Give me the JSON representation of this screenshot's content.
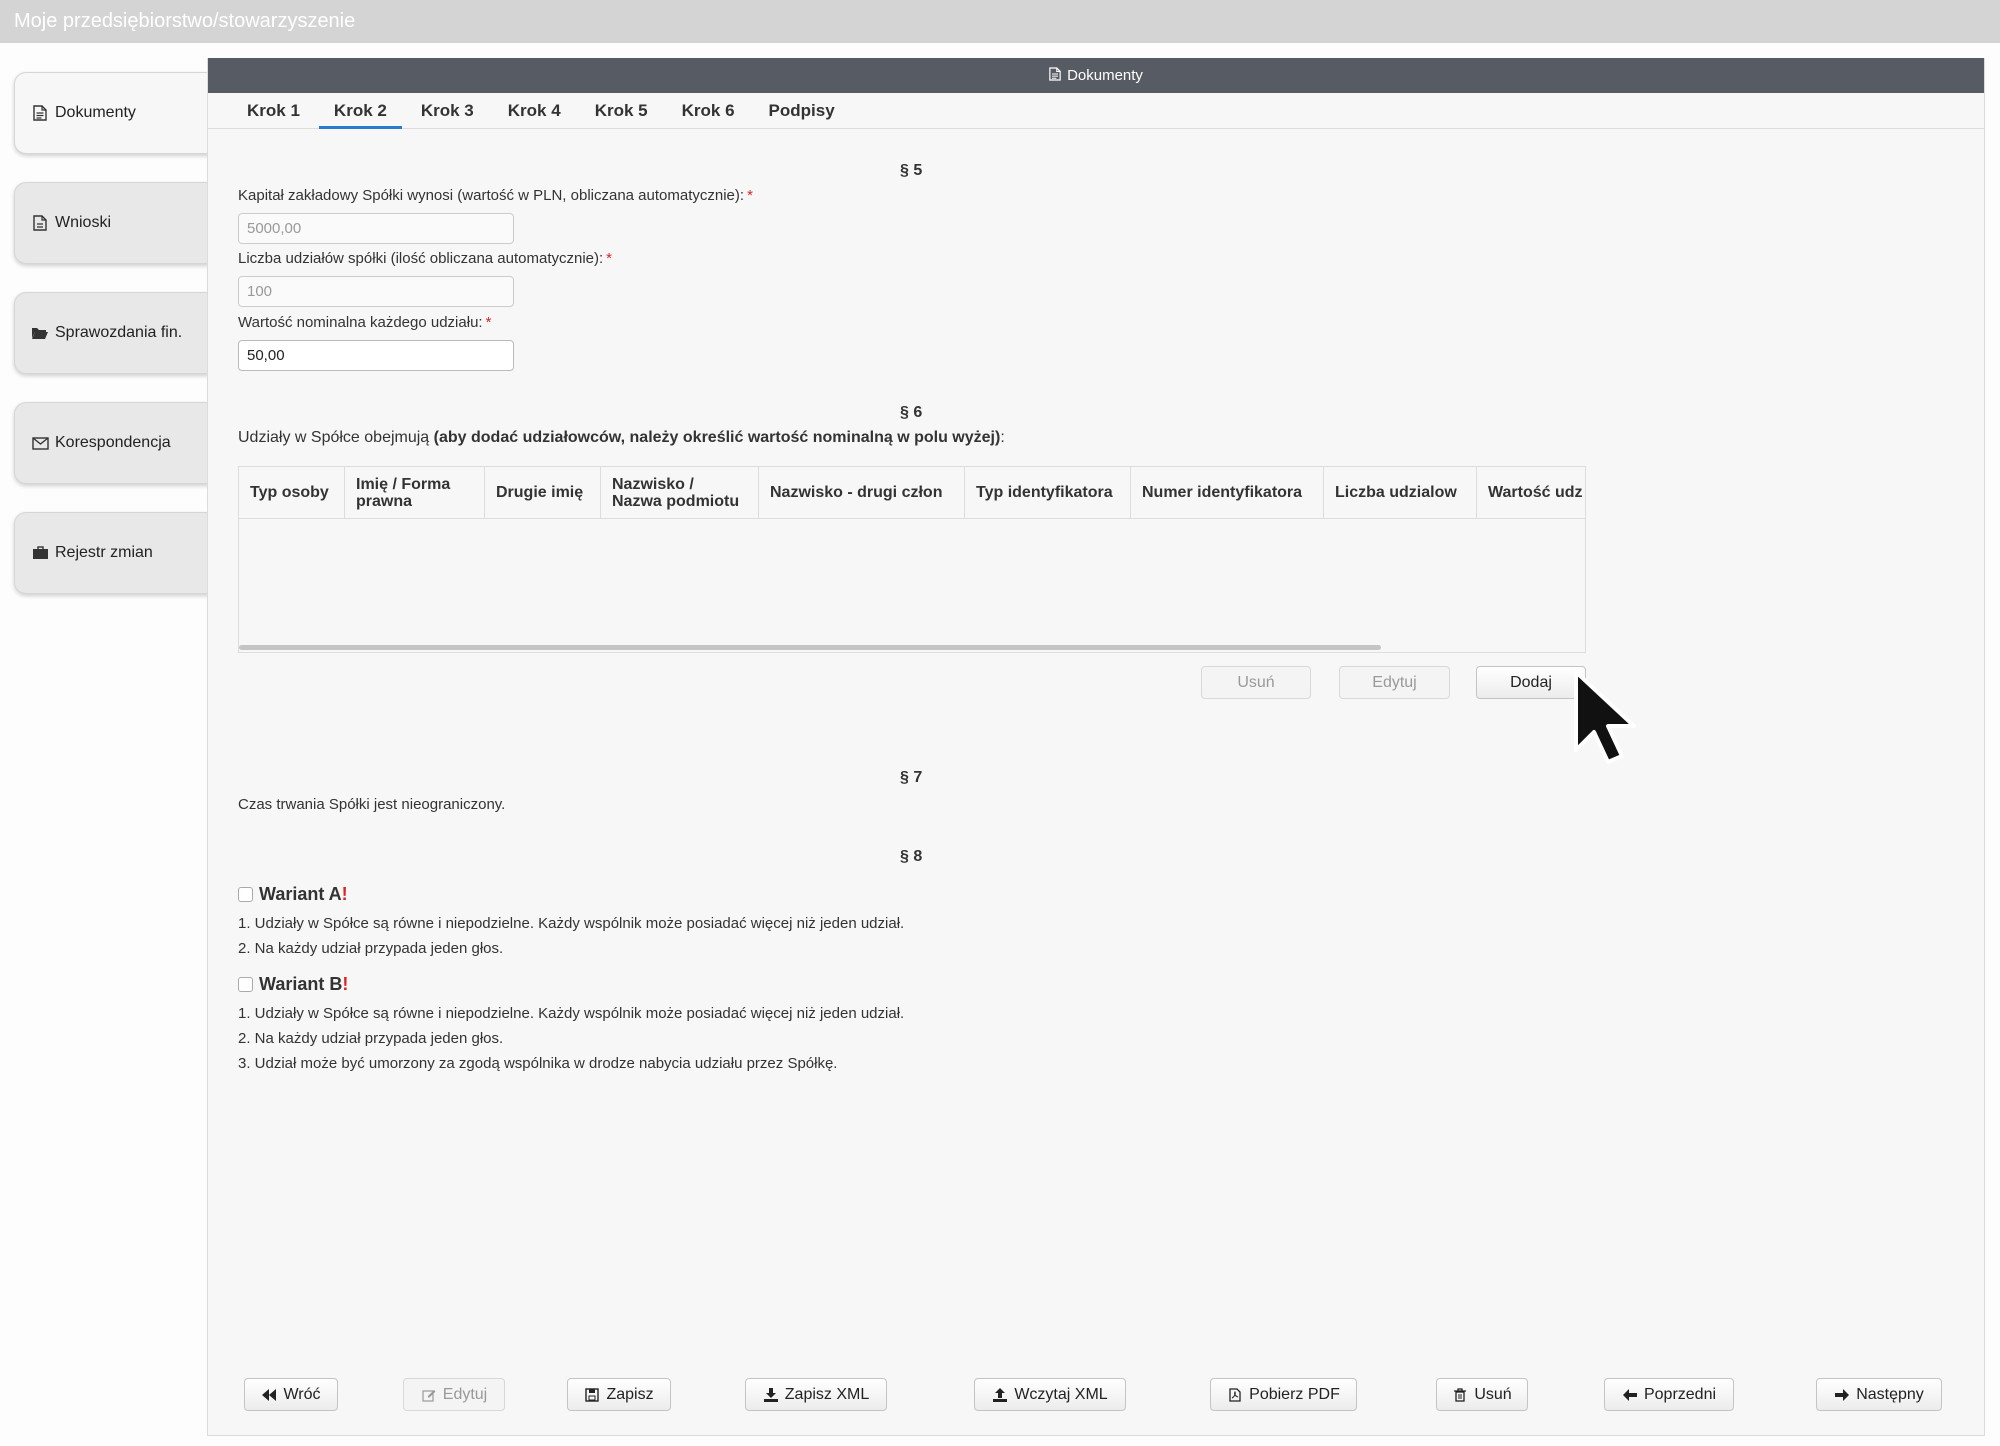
{
  "app": {
    "title": "Moje przedsiębiorstwo/stowarzyszenie"
  },
  "sidebar": {
    "items": [
      {
        "label": "Dokumenty",
        "icon": "document-icon"
      },
      {
        "label": "Wnioski",
        "icon": "document-icon"
      },
      {
        "label": "Sprawozdania fin.",
        "icon": "folder-open-icon"
      },
      {
        "label": "Korespondencja",
        "icon": "envelope-icon"
      },
      {
        "label": "Rejestr zmian",
        "icon": "briefcase-icon"
      }
    ]
  },
  "panel": {
    "title": "Dokumenty"
  },
  "tabs": [
    {
      "label": "Krok 1"
    },
    {
      "label": "Krok 2",
      "active": true
    },
    {
      "label": "Krok 3"
    },
    {
      "label": "Krok 4"
    },
    {
      "label": "Krok 5"
    },
    {
      "label": "Krok 6"
    },
    {
      "label": "Podpisy"
    }
  ],
  "s5": {
    "title": "§ 5",
    "capital_label": "Kapitał zakładowy Spółki wynosi (wartość w PLN, obliczana automatycznie):",
    "capital_value": "5000,00",
    "shares_label": "Liczba udziałów spółki (ilość obliczana automatycznie):",
    "shares_value": "100",
    "nominal_label": "Wartość nominalna każdego udziału:",
    "nominal_value": "50,00",
    "required_mark": "*"
  },
  "s6": {
    "title": "§ 6",
    "intro_plain": "Udziały w Spółce obejmują ",
    "intro_bold": "(aby dodać udziałowców, należy określić wartość nominalną w polu wyżej)",
    "intro_end": ":",
    "columns": [
      "Typ osoby",
      "Imię / Forma prawna",
      "Drugie imię",
      "Nazwisko / Nazwa podmiotu",
      "Nazwisko - drugi człon",
      "Typ identyfikatora",
      "Numer identyfikatora",
      "Liczba udzialow",
      "Wartość udz"
    ],
    "rows": [],
    "buttons": {
      "remove": "Usuń",
      "edit": "Edytuj",
      "add": "Dodaj"
    }
  },
  "s7": {
    "title": "§ 7",
    "text": "Czas trwania Spółki jest nieograniczony."
  },
  "s8": {
    "title": "§ 8",
    "variant_a": {
      "label": "Wariant A",
      "mark": "!",
      "checked": false,
      "lines": [
        "1. Udziały w Spółce są równe i niepodzielne. Każdy wspólnik może posiadać więcej niż jeden udział.",
        "2. Na każdy udział przypada jeden głos."
      ]
    },
    "variant_b": {
      "label": "Wariant B",
      "mark": "!",
      "checked": false,
      "lines": [
        "1. Udziały w Spółce są równe i niepodzielne. Każdy wspólnik może posiadać więcej niż jeden udział.",
        "2. Na każdy udział przypada jeden głos.",
        "3. Udział może być umorzony za zgodą wspólnika w drodze nabycia udziału przez Spółkę."
      ]
    }
  },
  "footer": {
    "back": "Wróć",
    "edit": "Edytuj",
    "save": "Zapisz",
    "save_xml": "Zapisz XML",
    "load_xml": "Wczytaj XML",
    "download_pdf": "Pobierz PDF",
    "delete": "Usuń",
    "previous": "Poprzedni",
    "next": "Następny"
  }
}
